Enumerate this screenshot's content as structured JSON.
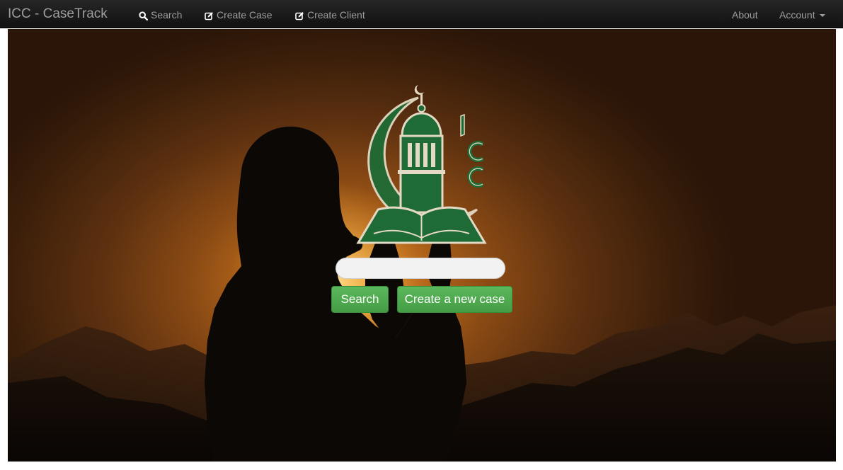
{
  "navbar": {
    "brand": "ICC - CaseTrack",
    "links": [
      {
        "label": "Search",
        "icon": "search-icon"
      },
      {
        "label": "Create Case",
        "icon": "edit-icon"
      },
      {
        "label": "Create Client",
        "icon": "edit-icon"
      }
    ],
    "right_links": [
      {
        "label": "About"
      },
      {
        "label": "Account",
        "icon": "caret-down-icon"
      }
    ]
  },
  "hero": {
    "background": "silhouette of a person praying against a sunset over mountains",
    "logo_text": "ICC",
    "search": {
      "value": "",
      "placeholder": ""
    },
    "buttons": {
      "search_label": "Search",
      "create_label": "Create a new case"
    }
  },
  "colors": {
    "navbar_bg": "#222222",
    "nav_text": "#9d9d9d",
    "button_green": "#5cb85c",
    "logo_green": "#1f6b35"
  }
}
